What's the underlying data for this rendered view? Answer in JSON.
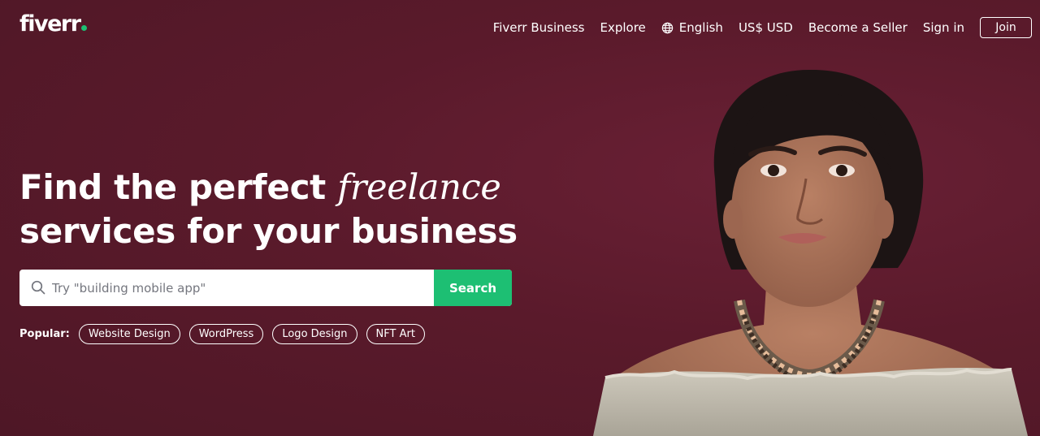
{
  "brand": {
    "logo_text": "fiverr",
    "logo_dot_color": "#1dbf73",
    "background_color": "#5a1a2b",
    "accent_color": "#1dbf73"
  },
  "nav": {
    "links": [
      "Fiverr Business",
      "Explore",
      "English",
      "US$ USD",
      "Become a Seller",
      "Sign in"
    ],
    "language_icon": "globe-icon",
    "join_label": "Join"
  },
  "hero": {
    "headline_part1": "Find the perfect",
    "headline_accent": "freelance",
    "headline_part2": "services for your business",
    "image_subject": "woman-with-beaded-necklace-portrait"
  },
  "search": {
    "icon": "search-icon",
    "placeholder": "Try \"building mobile app\"",
    "value": "",
    "button_label": "Search"
  },
  "popular": {
    "label": "Popular:",
    "tags": [
      "Website Design",
      "WordPress",
      "Logo Design",
      "NFT Art"
    ]
  }
}
